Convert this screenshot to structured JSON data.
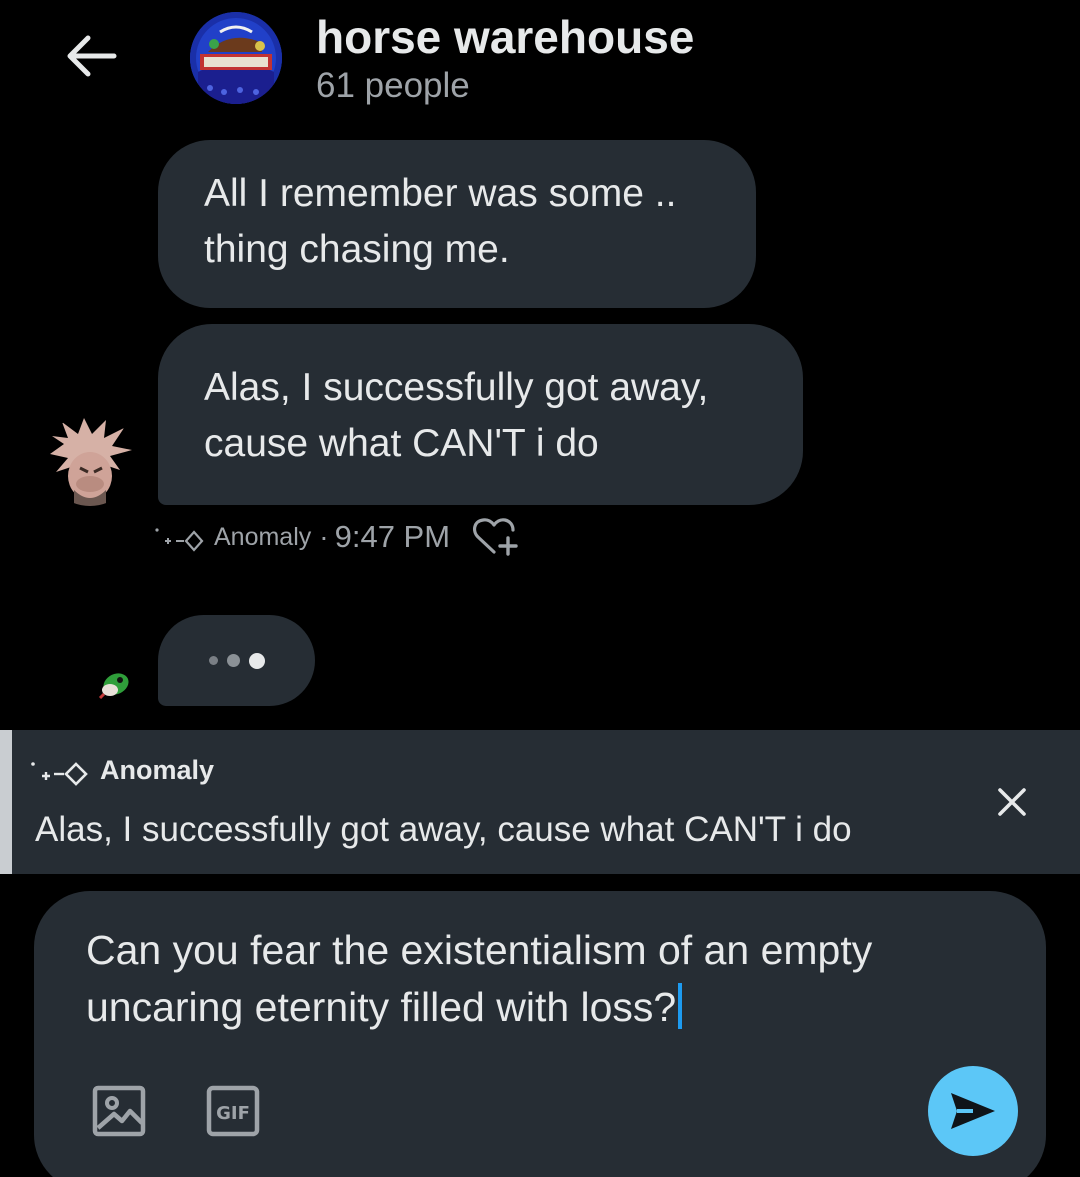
{
  "header": {
    "title": "horse warehouse",
    "subtitle": "61 people"
  },
  "messages": [
    {
      "lines": [
        "All I remember was some ..",
        "thing chasing me."
      ]
    },
    {
      "lines": [
        "Alas, I successfully got away,",
        "cause what CAN'T i do"
      ]
    }
  ],
  "meta": {
    "sender": "Anomaly",
    "separator": "·",
    "time": "9:47 PM"
  },
  "reply": {
    "sender": "Anomaly",
    "text": "Alas, I successfully got away, cause what CAN'T i do"
  },
  "composer": {
    "lines": [
      "Can you fear the existentialism of an empty",
      "uncaring eternity filled with loss?"
    ],
    "gif_label": "GIF"
  },
  "colors": {
    "background": "#000000",
    "bubble": "#262d34",
    "send": "#5cc7f7",
    "caret": "#1d9bf0",
    "muted_text": "#9ea3a8"
  }
}
